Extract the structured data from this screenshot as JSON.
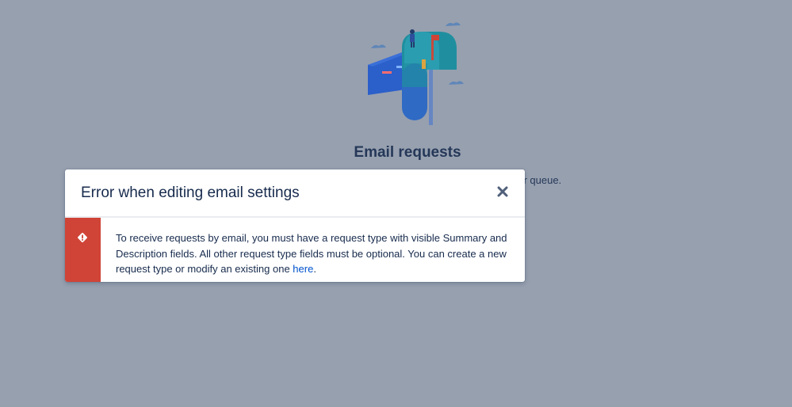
{
  "background": {
    "title": "Email requests",
    "subtitle_fragment": "our queue."
  },
  "modal": {
    "title": "Error when editing email settings",
    "close_icon": "close-icon",
    "error_icon": "error-icon",
    "message_text": "To receive requests by email, you must have a request type with visible Summary and Description fields. All other request type fields must be optional. You can create a new request type or modify an existing one ",
    "link_text": "here",
    "message_end": "."
  },
  "colors": {
    "overlay_background": "#97a0af",
    "error_red": "#d04437",
    "link_blue": "#0052cc",
    "text_dark": "#172b4d"
  }
}
